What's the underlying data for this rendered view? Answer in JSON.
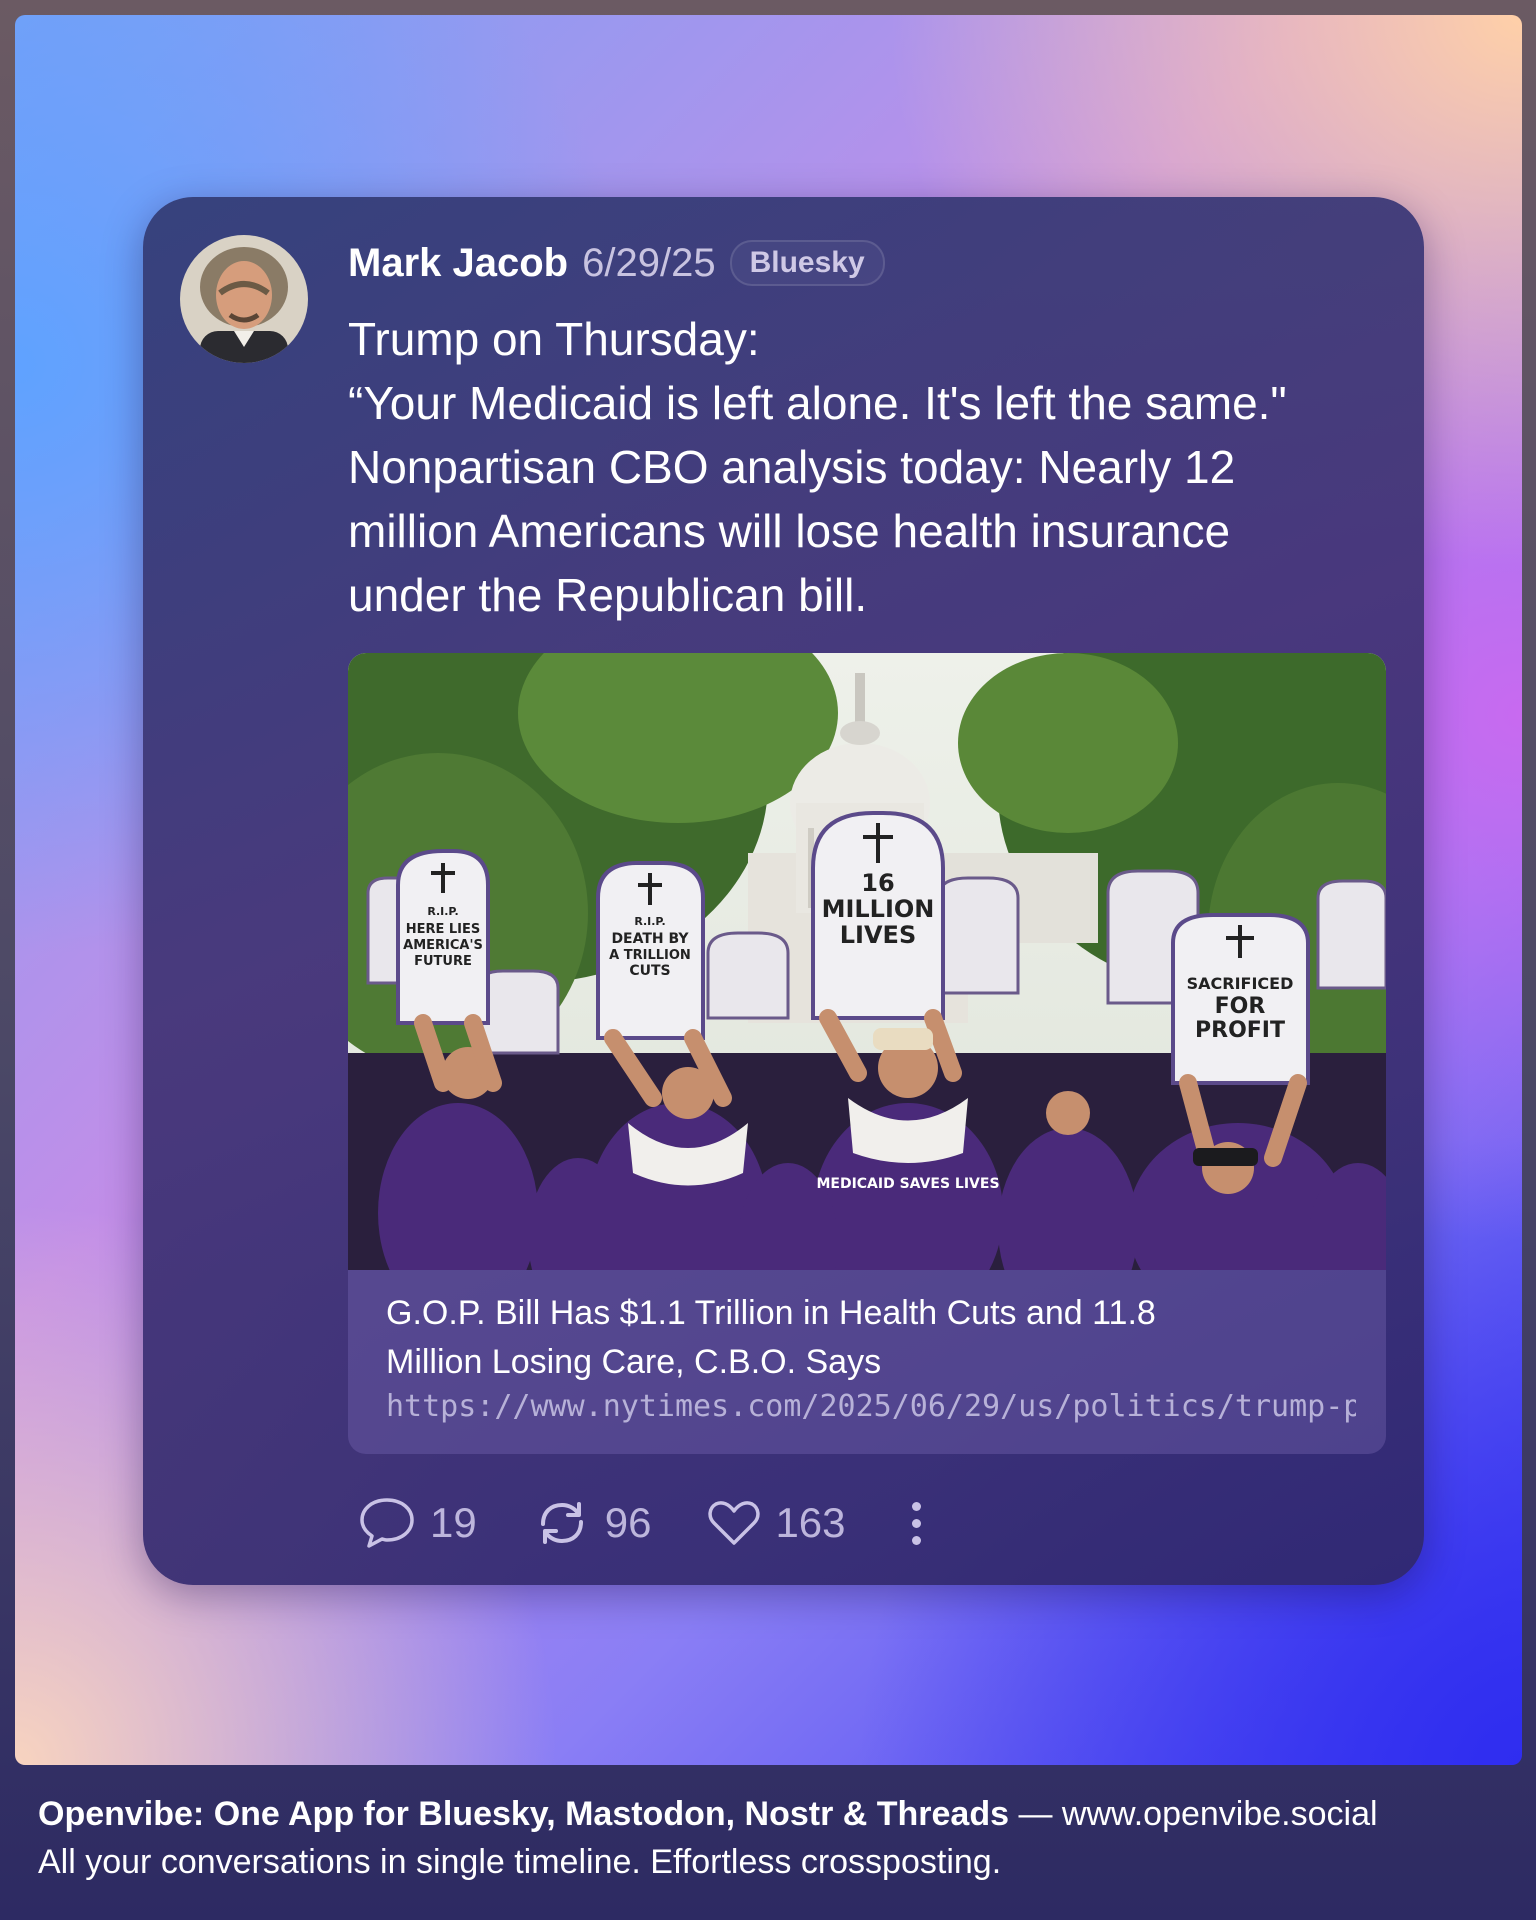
{
  "post": {
    "author": "Mark Jacob",
    "date": "6/29/25",
    "network": "Bluesky",
    "text_lines": [
      "Trump on Thursday:",
      "“Your Medicaid is left alone. It's left the same.\"",
      "Nonpartisan CBO analysis today: Nearly 12",
      "million Americans will lose health insurance",
      "under the Republican bill."
    ]
  },
  "link_card": {
    "title_line1": "G.O.P. Bill Has $1.1 Trillion in Health Cuts and 11.8",
    "title_line2": "Million Losing Care, C.B.O. Says",
    "url": "https://www.nytimes.com/2025/06/29/us/politics/trump-p...",
    "sign_texts": {
      "center": [
        "16",
        "MILLION",
        "LIVES"
      ],
      "right": [
        "SACRIFICED",
        "FOR",
        "PROFIT"
      ],
      "left": [
        "R.I.P.",
        "HERE LIES",
        "AMERICA'S",
        "FUTURE"
      ],
      "left_center": [
        "R.I.P.",
        "DEATH BY",
        "A TRILLION",
        "CUTS"
      ],
      "shirt": "MEDICAID SAVES LIVES"
    }
  },
  "stats": {
    "replies": "19",
    "reposts": "96",
    "likes": "163"
  },
  "footer": {
    "headline": "Openvibe: One App for Bluesky, Mastodon, Nostr & Threads",
    "separator": " — ",
    "url": "www.openvibe.social",
    "tagline": "All your conversations in single timeline. Effortless crossposting."
  },
  "icons": {
    "reply": "speech-bubble-icon",
    "repost": "repost-arrows-icon",
    "like": "heart-icon",
    "more": "vertical-dots-icon"
  },
  "colors": {
    "card_bg": "#3b3476",
    "text_primary": "#ffffff",
    "text_muted": "#bdb6dc"
  }
}
